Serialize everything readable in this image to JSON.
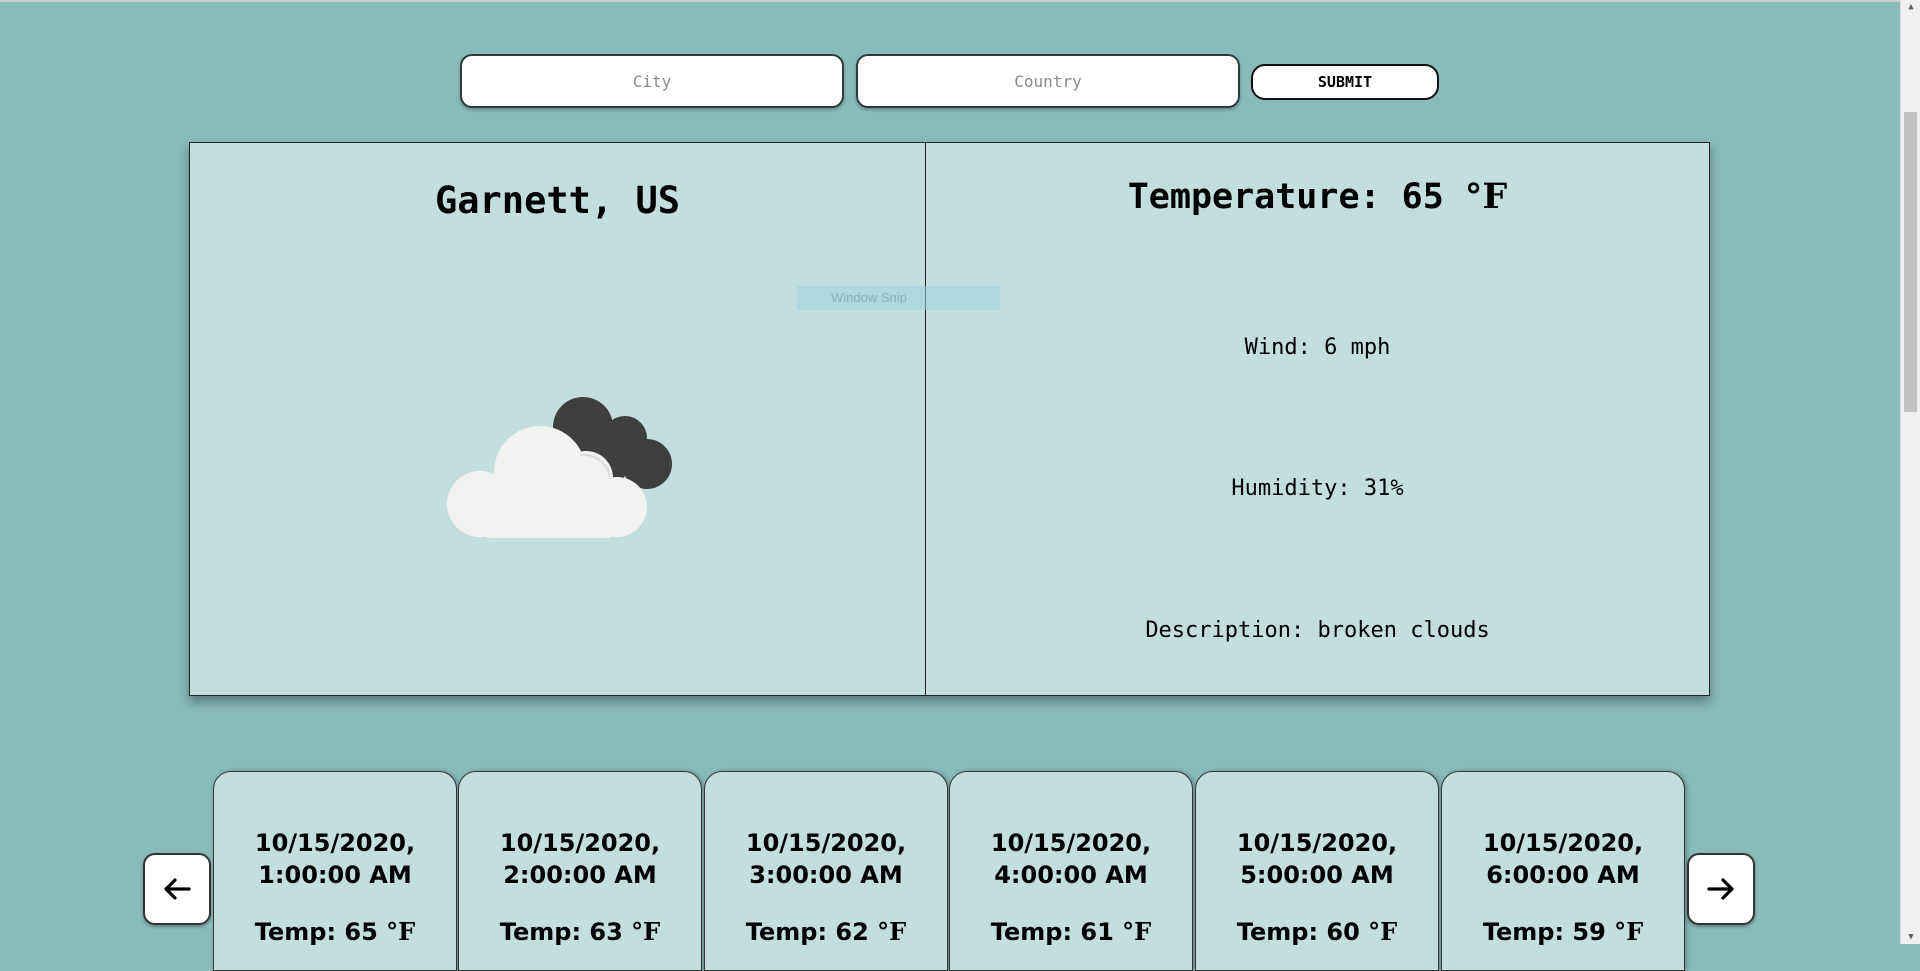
{
  "search": {
    "city_placeholder": "City",
    "country_placeholder": "Country",
    "submit_label": "SUBMIT"
  },
  "current": {
    "location": "Garnett, US",
    "icon": "broken-clouds-icon",
    "temperature_label": "Temperature: 65 ",
    "temperature_unit": "°F",
    "wind": "Wind: 6 mph",
    "humidity": "Humidity: 31%",
    "description": "Description: broken clouds"
  },
  "overlay": {
    "text": "Window Snip"
  },
  "forecast": {
    "prev_icon": "arrow-left-icon",
    "next_icon": "arrow-right-icon",
    "items": [
      {
        "date": "10/15/2020,",
        "time": "1:00:00 AM",
        "temp": "Temp: 65 ",
        "unit": "°F"
      },
      {
        "date": "10/15/2020,",
        "time": "2:00:00 AM",
        "temp": "Temp: 63 ",
        "unit": "°F"
      },
      {
        "date": "10/15/2020,",
        "time": "3:00:00 AM",
        "temp": "Temp: 62 ",
        "unit": "°F"
      },
      {
        "date": "10/15/2020,",
        "time": "4:00:00 AM",
        "temp": "Temp: 61 ",
        "unit": "°F"
      },
      {
        "date": "10/15/2020,",
        "time": "5:00:00 AM",
        "temp": "Temp: 60 ",
        "unit": "°F"
      },
      {
        "date": "10/15/2020,",
        "time": "6:00:00 AM",
        "temp": "Temp: 59 ",
        "unit": "°F"
      }
    ]
  },
  "colors": {
    "background": "#89bbb9",
    "card": "#c2dedd"
  }
}
